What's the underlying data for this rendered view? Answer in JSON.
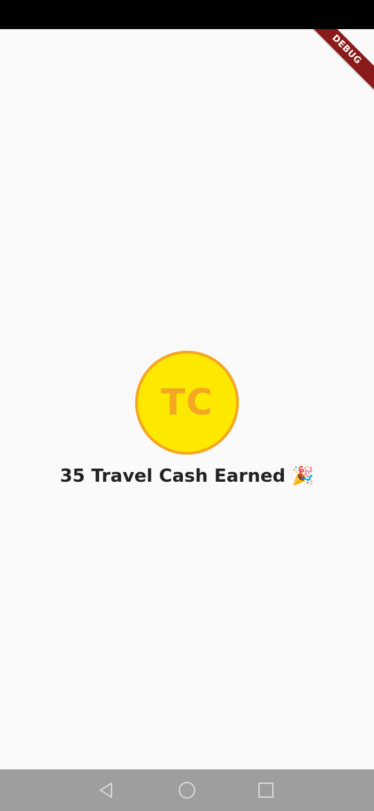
{
  "debug_banner": {
    "label": "DEBUG"
  },
  "reward": {
    "coin_label": "TC",
    "message": "35 Travel Cash Earned 🎉"
  },
  "colors": {
    "coin_fill": "#fde800",
    "coin_border": "#f5a623",
    "debug_ribbon": "#8b1a1a",
    "nav_bar": "#9e9e9e"
  },
  "navigation": {
    "back_icon": "triangle-back-icon",
    "home_icon": "circle-home-icon",
    "recent_icon": "square-recent-apps-icon"
  }
}
